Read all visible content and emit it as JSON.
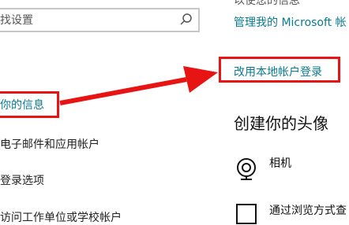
{
  "search": {
    "placeholder": "找设置"
  },
  "nav": {
    "items": [
      {
        "label": "你的信息",
        "active": true
      },
      {
        "label": "电子邮件和应用帐户",
        "active": false
      },
      {
        "label": "登录选项",
        "active": false
      },
      {
        "label": "访问工作单位或学校帐户",
        "active": false
      }
    ]
  },
  "account": {
    "top_text": "以使您的信息",
    "manage_link": "管理我的 Microsoft 帐",
    "local_account_link": "改用本地帐户登录"
  },
  "avatar_section": {
    "title": "创建你的头像",
    "camera_label": "相机",
    "browse_label": "通过浏览方式查"
  },
  "colors": {
    "accent": "#0a7a8f",
    "annotation_red": "#e81414",
    "search_border": "#c8c8c8"
  },
  "icons": {
    "search": "search-icon",
    "camera": "camera-icon",
    "browse": "browse-icon"
  }
}
